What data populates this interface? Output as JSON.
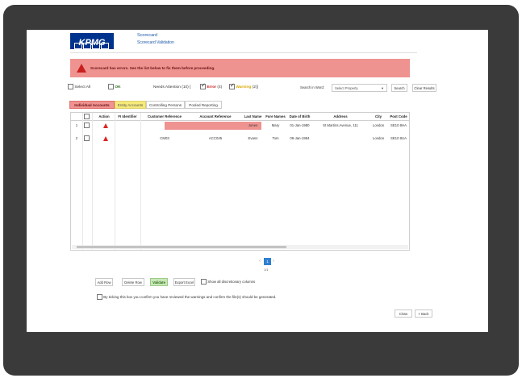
{
  "header": {
    "logo": "KPMG",
    "title": "Scorecard",
    "subtitle": "Scorecard Validation"
  },
  "alert": {
    "message": "Scorecard has errors. See the list below to fix them before proceeding."
  },
  "filters": {
    "select_all": "Select All",
    "ok": "OK",
    "needs_attention": "Needs Attention",
    "needs_attention_count": "(10) [",
    "error": "Error",
    "error_count": "(4)",
    "warning": "Warning",
    "warning_count": "(2)]",
    "search_label": "Search in Word:",
    "select_placeholder": "Select Property",
    "search_button": "Search",
    "clear_button": "Clear Results"
  },
  "tabs": [
    {
      "label": "Individual Accounts"
    },
    {
      "label": "Entity Accounts"
    },
    {
      "label": "Controlling Persons"
    },
    {
      "label": "Pooled Reporting"
    }
  ],
  "table": {
    "columns": [
      "Action",
      "FI Identifier",
      "Customer Reference",
      "Account Reference",
      "Last Name",
      "Fore Names",
      "Date of Birth",
      "Address",
      "City",
      "Post Code"
    ],
    "rows": [
      {
        "num": "1",
        "fi": "",
        "customer": "",
        "account": "",
        "last": "Jones",
        "fore": "Mary",
        "dob": "01-Jan-1980",
        "address": "St Martins Avenue, 111",
        "city": "London",
        "post": "SE10 8HA"
      },
      {
        "num": "2",
        "fi": "",
        "customer": "CM03",
        "account": "ACC045",
        "last": "Evans",
        "fore": "Tom",
        "dob": "09-Jan-1984",
        "address": "",
        "city": "London",
        "post": "SE10 8UA"
      }
    ]
  },
  "pager": {
    "current": "1",
    "info": "1/1"
  },
  "actions": {
    "add_row": "Add Row",
    "delete_row": "Delete Row",
    "validate": "Validate",
    "export_excel": "Export Excel",
    "show_discretionary": "Show all discretionary columns"
  },
  "confirm": {
    "text": "By ticking this box you confirm you have reviewed the warnings and confirm the file(s) should be generated.",
    "close": "Close",
    "back": "< Back"
  },
  "colors": {
    "error": "#ef9391",
    "warning": "#f6ea7a",
    "ok": "#2d6a1c",
    "brand": "#00338d"
  }
}
